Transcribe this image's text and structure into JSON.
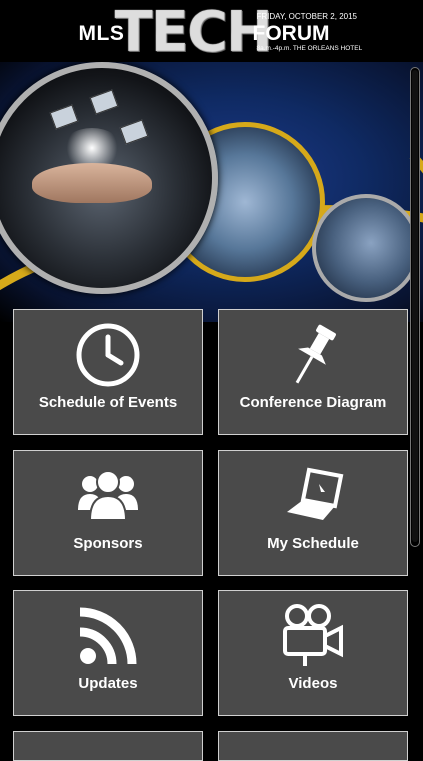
{
  "header": {
    "logo_left": "MLS",
    "logo_main": "TECH",
    "logo_right": "FORUM",
    "date": "FRIDAY, OCTOBER 2, 2015",
    "venue": "8a.m.-4p.m. THE ORLEANS HOTEL"
  },
  "tiles": [
    {
      "label": "Schedule of Events",
      "icon": "clock-icon"
    },
    {
      "label": "Conference Diagram",
      "icon": "pushpin-icon"
    },
    {
      "label": "Sponsors",
      "icon": "people-group-icon"
    },
    {
      "label": "My Schedule",
      "icon": "laptop-icon"
    },
    {
      "label": "Updates",
      "icon": "rss-icon"
    },
    {
      "label": "Videos",
      "icon": "video-camera-icon"
    }
  ],
  "colors": {
    "tile_bg": "#4a4a4a",
    "tile_border": "#d0d0d0",
    "accent_gold": "#d6a91a"
  }
}
